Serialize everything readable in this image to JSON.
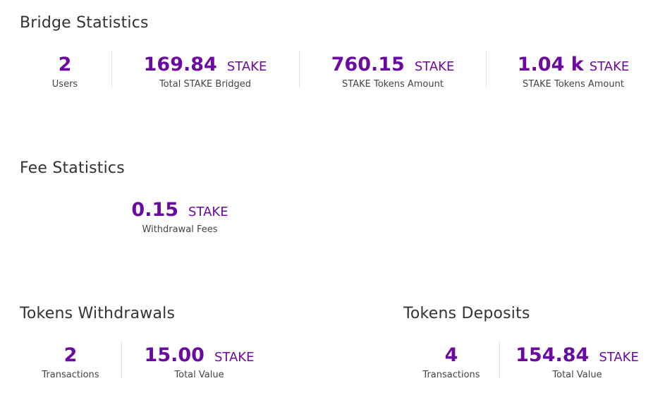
{
  "bridge": {
    "title": "Bridge Statistics",
    "stats": [
      {
        "value": "2",
        "unit": "",
        "label": "Users"
      },
      {
        "value": "169.84",
        "unit": "STAKE",
        "label": "Total STAKE Bridged"
      },
      {
        "value": "760.15",
        "unit": "STAKE",
        "label": "STAKE Tokens Amount"
      },
      {
        "value": "1.04 k",
        "unit": "STAKE",
        "label": "STAKE Tokens Amount"
      }
    ]
  },
  "fees": {
    "title": "Fee Statistics",
    "stats": [
      {
        "value": "0.15",
        "unit": "STAKE",
        "label": "Withdrawal Fees"
      }
    ]
  },
  "withdrawals": {
    "title": "Tokens Withdrawals",
    "stats": [
      {
        "value": "2",
        "unit": "",
        "label": "Transactions"
      },
      {
        "value": "15.00",
        "unit": "STAKE",
        "label": "Total Value"
      }
    ]
  },
  "deposits": {
    "title": "Tokens Deposits",
    "stats": [
      {
        "value": "4",
        "unit": "",
        "label": "Transactions"
      },
      {
        "value": "154.84",
        "unit": "STAKE",
        "label": "Total Value"
      }
    ]
  },
  "colors": {
    "accent": "#6a0aa0",
    "text": "#333333",
    "divider": "#e3e3e3"
  }
}
